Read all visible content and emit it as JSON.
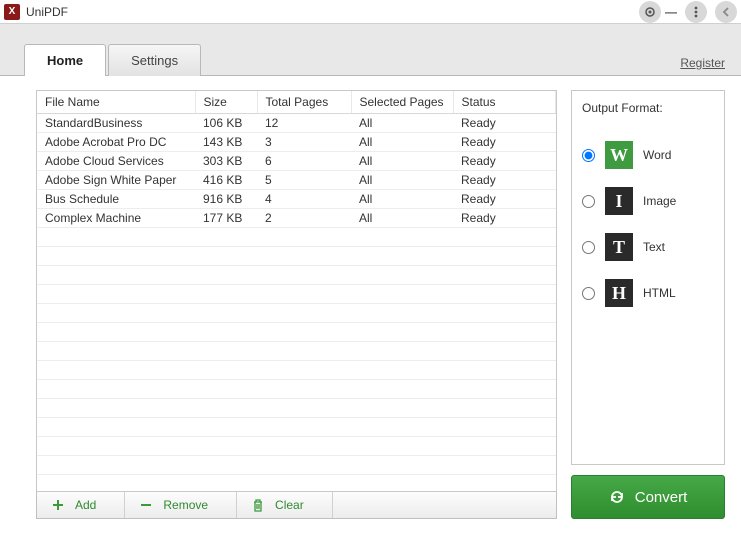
{
  "app": {
    "title": "UniPDF",
    "register_link": "Register"
  },
  "tabs": {
    "home": "Home",
    "settings": "Settings"
  },
  "columns": {
    "name": "File Name",
    "size": "Size",
    "pages": "Total Pages",
    "selected": "Selected Pages",
    "status": "Status"
  },
  "files": [
    {
      "name": "StandardBusiness",
      "size": "106 KB",
      "pages": "12",
      "selected": "All",
      "status": "Ready"
    },
    {
      "name": "Adobe Acrobat Pro DC",
      "size": "143 KB",
      "pages": "3",
      "selected": "All",
      "status": "Ready"
    },
    {
      "name": "Adobe Cloud Services",
      "size": "303 KB",
      "pages": "6",
      "selected": "All",
      "status": "Ready"
    },
    {
      "name": "Adobe Sign White Paper",
      "size": "416 KB",
      "pages": "5",
      "selected": "All",
      "status": "Ready"
    },
    {
      "name": "Bus Schedule",
      "size": "916 KB",
      "pages": "4",
      "selected": "All",
      "status": "Ready"
    },
    {
      "name": "Complex Machine",
      "size": "177 KB",
      "pages": "2",
      "selected": "All",
      "status": "Ready"
    }
  ],
  "toolbar": {
    "add": "Add",
    "remove": "Remove",
    "clear": "Clear"
  },
  "output": {
    "title": "Output Format:",
    "options": {
      "word": "Word",
      "image": "Image",
      "text": "Text",
      "html": "HTML"
    },
    "selected": "word"
  },
  "convert_label": "Convert"
}
